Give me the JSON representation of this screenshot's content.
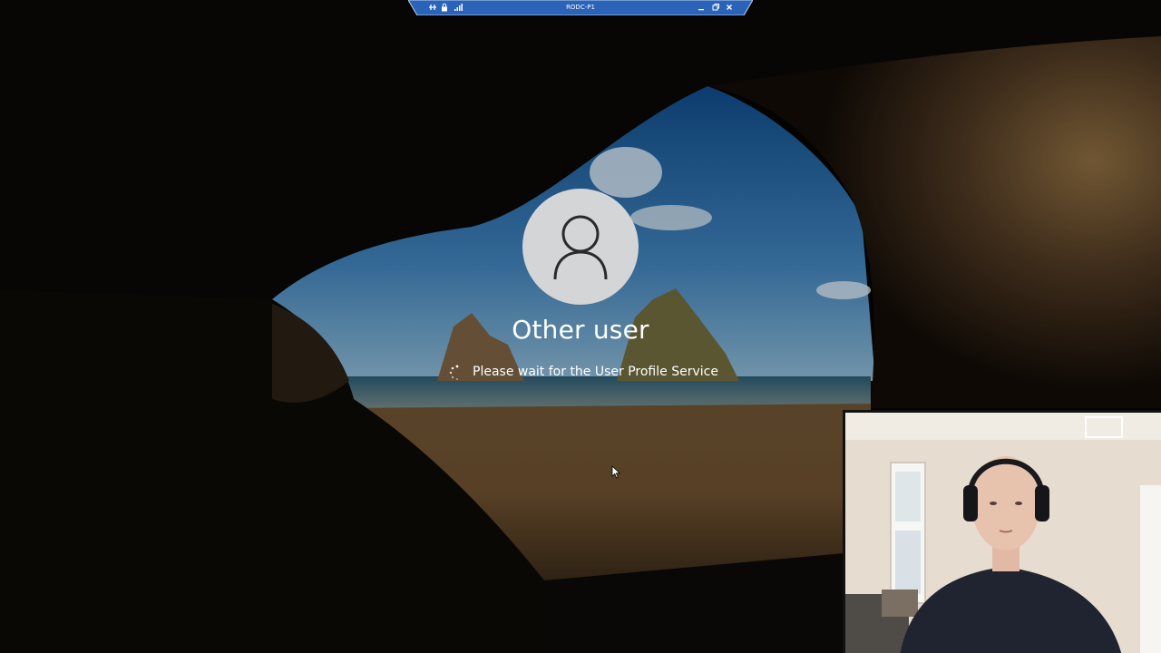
{
  "rdp_bar": {
    "title": "RODC-P1",
    "minimize_icon": "minimize-icon",
    "restore_icon": "restore-icon",
    "close_icon": "close-icon",
    "pin_icon": "pin-icon",
    "lock_icon": "lock-icon",
    "signal_icon": "signal-icon"
  },
  "login": {
    "username": "Other user",
    "status": "Please wait for the User Profile Service",
    "avatar_icon": "user-avatar-icon",
    "spinner_icon": "loading-spinner-icon"
  },
  "colors": {
    "rdp_bar": "#2a63b8",
    "avatar_bg": "#d4d5d6",
    "text": "#ffffff"
  }
}
